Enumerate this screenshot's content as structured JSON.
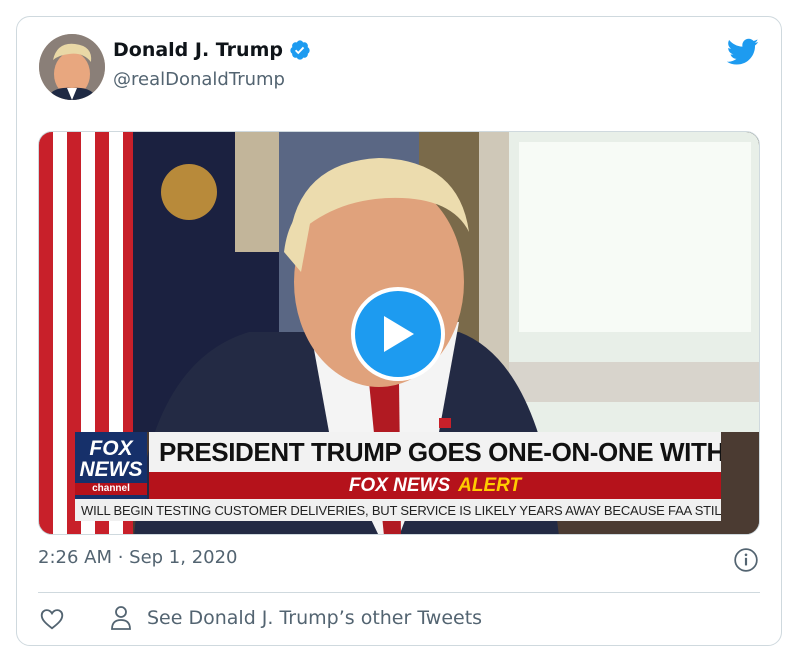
{
  "tweet": {
    "author_name": "Donald J. Trump",
    "handle": "@realDonaldTrump",
    "timestamp": "2:26 AM · Sep 1, 2020",
    "verified": true,
    "icons": {
      "avatar": "avatar",
      "verified": "verified-badge-icon",
      "brand": "twitter-bird-icon",
      "info": "info-icon",
      "like": "heart-icon",
      "profile": "person-icon",
      "play": "play-icon"
    }
  },
  "video": {
    "chyron_headline": "PRESIDENT TRUMP GOES ONE-ON-ONE WITH LAURA",
    "alert_brand": "FOX NEWS",
    "alert_word": "ALERT",
    "ticker": "WILL BEGIN TESTING CUSTOMER DELIVERIES, BUT SERVICE IS LIKELY YEARS AWAY BECAUSE FAA STILL NEEDS",
    "logo_line1": "FOX",
    "logo_line2": "NEWS",
    "logo_line3": "channel"
  },
  "actions": {
    "other_tweets_label": "See Donald J. Trump’s other Tweets"
  },
  "colors": {
    "brand_blue": "#1d9bf0",
    "secondary_text": "#536471",
    "border": "#cfd9de",
    "fox_red": "#b5121b",
    "fox_navy": "#16306a"
  }
}
